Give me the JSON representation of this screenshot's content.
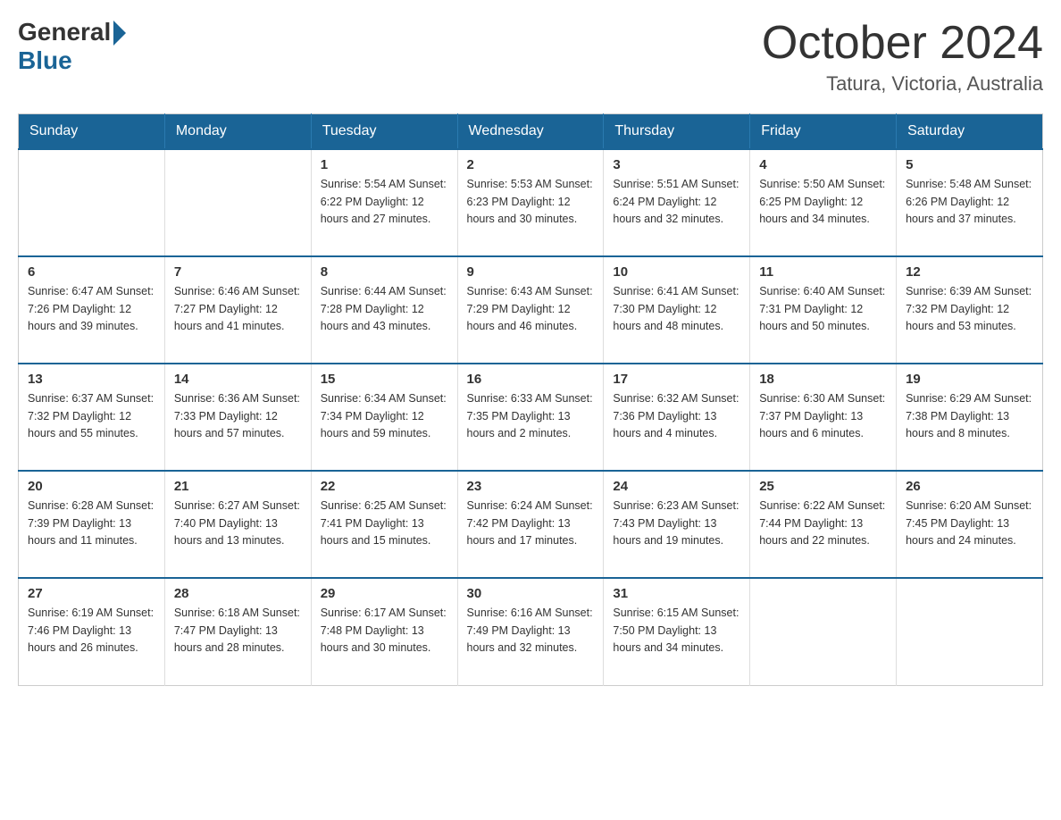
{
  "logo": {
    "general": "General",
    "blue": "Blue"
  },
  "title": "October 2024",
  "location": "Tatura, Victoria, Australia",
  "days_of_week": [
    "Sunday",
    "Monday",
    "Tuesday",
    "Wednesday",
    "Thursday",
    "Friday",
    "Saturday"
  ],
  "weeks": [
    [
      {
        "day": "",
        "info": ""
      },
      {
        "day": "",
        "info": ""
      },
      {
        "day": "1",
        "info": "Sunrise: 5:54 AM\nSunset: 6:22 PM\nDaylight: 12 hours\nand 27 minutes."
      },
      {
        "day": "2",
        "info": "Sunrise: 5:53 AM\nSunset: 6:23 PM\nDaylight: 12 hours\nand 30 minutes."
      },
      {
        "day": "3",
        "info": "Sunrise: 5:51 AM\nSunset: 6:24 PM\nDaylight: 12 hours\nand 32 minutes."
      },
      {
        "day": "4",
        "info": "Sunrise: 5:50 AM\nSunset: 6:25 PM\nDaylight: 12 hours\nand 34 minutes."
      },
      {
        "day": "5",
        "info": "Sunrise: 5:48 AM\nSunset: 6:26 PM\nDaylight: 12 hours\nand 37 minutes."
      }
    ],
    [
      {
        "day": "6",
        "info": "Sunrise: 6:47 AM\nSunset: 7:26 PM\nDaylight: 12 hours\nand 39 minutes."
      },
      {
        "day": "7",
        "info": "Sunrise: 6:46 AM\nSunset: 7:27 PM\nDaylight: 12 hours\nand 41 minutes."
      },
      {
        "day": "8",
        "info": "Sunrise: 6:44 AM\nSunset: 7:28 PM\nDaylight: 12 hours\nand 43 minutes."
      },
      {
        "day": "9",
        "info": "Sunrise: 6:43 AM\nSunset: 7:29 PM\nDaylight: 12 hours\nand 46 minutes."
      },
      {
        "day": "10",
        "info": "Sunrise: 6:41 AM\nSunset: 7:30 PM\nDaylight: 12 hours\nand 48 minutes."
      },
      {
        "day": "11",
        "info": "Sunrise: 6:40 AM\nSunset: 7:31 PM\nDaylight: 12 hours\nand 50 minutes."
      },
      {
        "day": "12",
        "info": "Sunrise: 6:39 AM\nSunset: 7:32 PM\nDaylight: 12 hours\nand 53 minutes."
      }
    ],
    [
      {
        "day": "13",
        "info": "Sunrise: 6:37 AM\nSunset: 7:32 PM\nDaylight: 12 hours\nand 55 minutes."
      },
      {
        "day": "14",
        "info": "Sunrise: 6:36 AM\nSunset: 7:33 PM\nDaylight: 12 hours\nand 57 minutes."
      },
      {
        "day": "15",
        "info": "Sunrise: 6:34 AM\nSunset: 7:34 PM\nDaylight: 12 hours\nand 59 minutes."
      },
      {
        "day": "16",
        "info": "Sunrise: 6:33 AM\nSunset: 7:35 PM\nDaylight: 13 hours\nand 2 minutes."
      },
      {
        "day": "17",
        "info": "Sunrise: 6:32 AM\nSunset: 7:36 PM\nDaylight: 13 hours\nand 4 minutes."
      },
      {
        "day": "18",
        "info": "Sunrise: 6:30 AM\nSunset: 7:37 PM\nDaylight: 13 hours\nand 6 minutes."
      },
      {
        "day": "19",
        "info": "Sunrise: 6:29 AM\nSunset: 7:38 PM\nDaylight: 13 hours\nand 8 minutes."
      }
    ],
    [
      {
        "day": "20",
        "info": "Sunrise: 6:28 AM\nSunset: 7:39 PM\nDaylight: 13 hours\nand 11 minutes."
      },
      {
        "day": "21",
        "info": "Sunrise: 6:27 AM\nSunset: 7:40 PM\nDaylight: 13 hours\nand 13 minutes."
      },
      {
        "day": "22",
        "info": "Sunrise: 6:25 AM\nSunset: 7:41 PM\nDaylight: 13 hours\nand 15 minutes."
      },
      {
        "day": "23",
        "info": "Sunrise: 6:24 AM\nSunset: 7:42 PM\nDaylight: 13 hours\nand 17 minutes."
      },
      {
        "day": "24",
        "info": "Sunrise: 6:23 AM\nSunset: 7:43 PM\nDaylight: 13 hours\nand 19 minutes."
      },
      {
        "day": "25",
        "info": "Sunrise: 6:22 AM\nSunset: 7:44 PM\nDaylight: 13 hours\nand 22 minutes."
      },
      {
        "day": "26",
        "info": "Sunrise: 6:20 AM\nSunset: 7:45 PM\nDaylight: 13 hours\nand 24 minutes."
      }
    ],
    [
      {
        "day": "27",
        "info": "Sunrise: 6:19 AM\nSunset: 7:46 PM\nDaylight: 13 hours\nand 26 minutes."
      },
      {
        "day": "28",
        "info": "Sunrise: 6:18 AM\nSunset: 7:47 PM\nDaylight: 13 hours\nand 28 minutes."
      },
      {
        "day": "29",
        "info": "Sunrise: 6:17 AM\nSunset: 7:48 PM\nDaylight: 13 hours\nand 30 minutes."
      },
      {
        "day": "30",
        "info": "Sunrise: 6:16 AM\nSunset: 7:49 PM\nDaylight: 13 hours\nand 32 minutes."
      },
      {
        "day": "31",
        "info": "Sunrise: 6:15 AM\nSunset: 7:50 PM\nDaylight: 13 hours\nand 34 minutes."
      },
      {
        "day": "",
        "info": ""
      },
      {
        "day": "",
        "info": ""
      }
    ]
  ]
}
